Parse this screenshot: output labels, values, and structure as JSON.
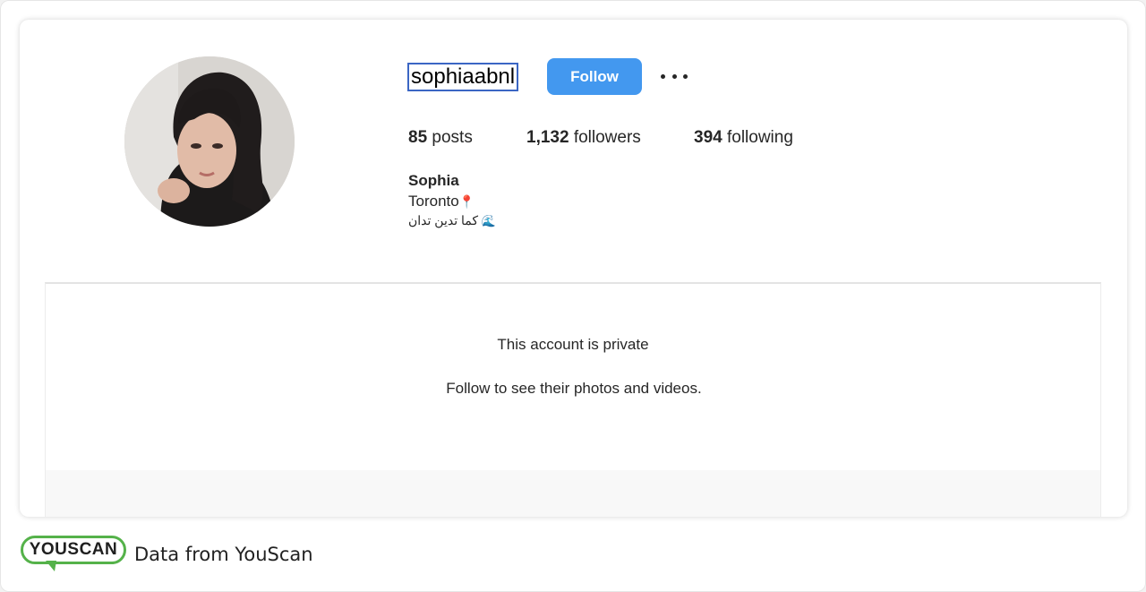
{
  "profile": {
    "username": "sophiaabnl",
    "follow_label": "Follow",
    "more_icon": "more-horizontal-icon",
    "stats": {
      "posts_count": "85",
      "posts_label": " posts",
      "followers_count": "1,132",
      "followers_label": " followers",
      "following_count": "394",
      "following_label": " following"
    },
    "bio": {
      "name": "Sophia",
      "location": "Toronto",
      "location_emoji": "📍",
      "line": "كما تدين تدان",
      "line_emoji": "🌊"
    }
  },
  "private_notice": {
    "title": "This account is private",
    "subtitle": "Follow to see their photos and videos."
  },
  "footer": {
    "logo_text": "YOUSCAN",
    "text": "Data from YouScan"
  },
  "colors": {
    "follow_button": "#4398ef",
    "logo_green": "#55b24a",
    "username_focus_border": "#3b66c4"
  }
}
